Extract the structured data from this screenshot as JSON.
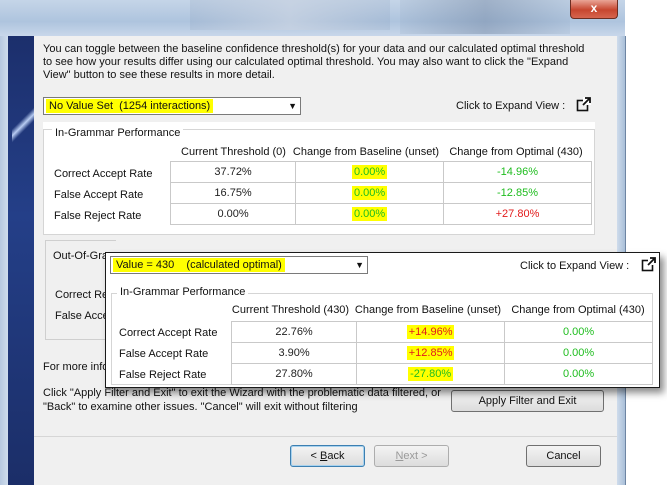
{
  "window": {
    "close_glyph": "x",
    "colors": {
      "title_gradient_top": "#c5d5e8",
      "banner": "#1c2f6c",
      "close": "#c7462f"
    }
  },
  "intro_text": "You can toggle between the baseline confidence threshold(s) for your data and our calculated optimal threshold to see how your results differ using our calculated optimal threshold. You may also want to click the \"Expand View\" button to see these results in more detail.",
  "top_view": {
    "selector": {
      "value": "No Value Set  (1254 interactions)",
      "arrow_icon": "dropdown-arrow-icon"
    },
    "expand_label": "Click to Expand View :",
    "expand_icon": "external-link-icon",
    "group_title": "In-Grammar Performance",
    "columns": [
      "Current Threshold (0)",
      "Change from Baseline (unset)",
      "Change from Optimal (430)"
    ],
    "rows": [
      {
        "label": "Correct Accept Rate",
        "current": "37.72%",
        "baseline": "0.00%",
        "optimal": "-14.96%"
      },
      {
        "label": "False Accept Rate",
        "current": "16.75%",
        "baseline": "0.00%",
        "optimal": "-12.85%"
      },
      {
        "label": "False Reject Rate",
        "current": "0.00%",
        "baseline": "0.00%",
        "optimal": "+27.80%"
      }
    ]
  },
  "popup_view": {
    "selector": {
      "value": "Value = 430    (calculated optimal)",
      "arrow_icon": "dropdown-arrow-icon"
    },
    "expand_label": "Click to Expand View :",
    "expand_icon": "external-link-icon",
    "group_title": "In-Grammar Performance",
    "columns": [
      "Current Threshold (430)",
      "Change from Baseline (unset)",
      "Change from Optimal (430)"
    ],
    "rows": [
      {
        "label": "Correct Accept Rate",
        "current": "22.76%",
        "baseline": "+14.96%",
        "optimal": "0.00%"
      },
      {
        "label": "False Accept Rate",
        "current": "3.90%",
        "baseline": "+12.85%",
        "optimal": "0.00%"
      },
      {
        "label": "False Reject Rate",
        "current": "27.80%",
        "baseline": "-27.80%",
        "optimal": "0.00%"
      }
    ]
  },
  "background": {
    "out_of_grammar_title": "Out-Of-Gra",
    "ooh_row1": "Correct Re",
    "ooh_row2": "False Acce",
    "more_info": "For more infor",
    "click_apply_line1": "Click \"Apply Filter and Exit\" to exit the Wizard with the problematic data filtered, or",
    "click_apply_line2": "\"Back\" to examine other issues. \"Cancel\" will exit without filtering"
  },
  "buttons": {
    "apply": "Apply Filter and Exit",
    "back_mnemonic": "B",
    "back_rest": "ack",
    "back_prefix": "< ",
    "next_mnemonic": "N",
    "next_rest": "ext",
    "next_suffix": " >",
    "cancel": "Cancel"
  },
  "colors": {
    "highlight": "#ffff00",
    "positive_green": "#1fbd1f",
    "negative_red": "#e21b1b"
  }
}
